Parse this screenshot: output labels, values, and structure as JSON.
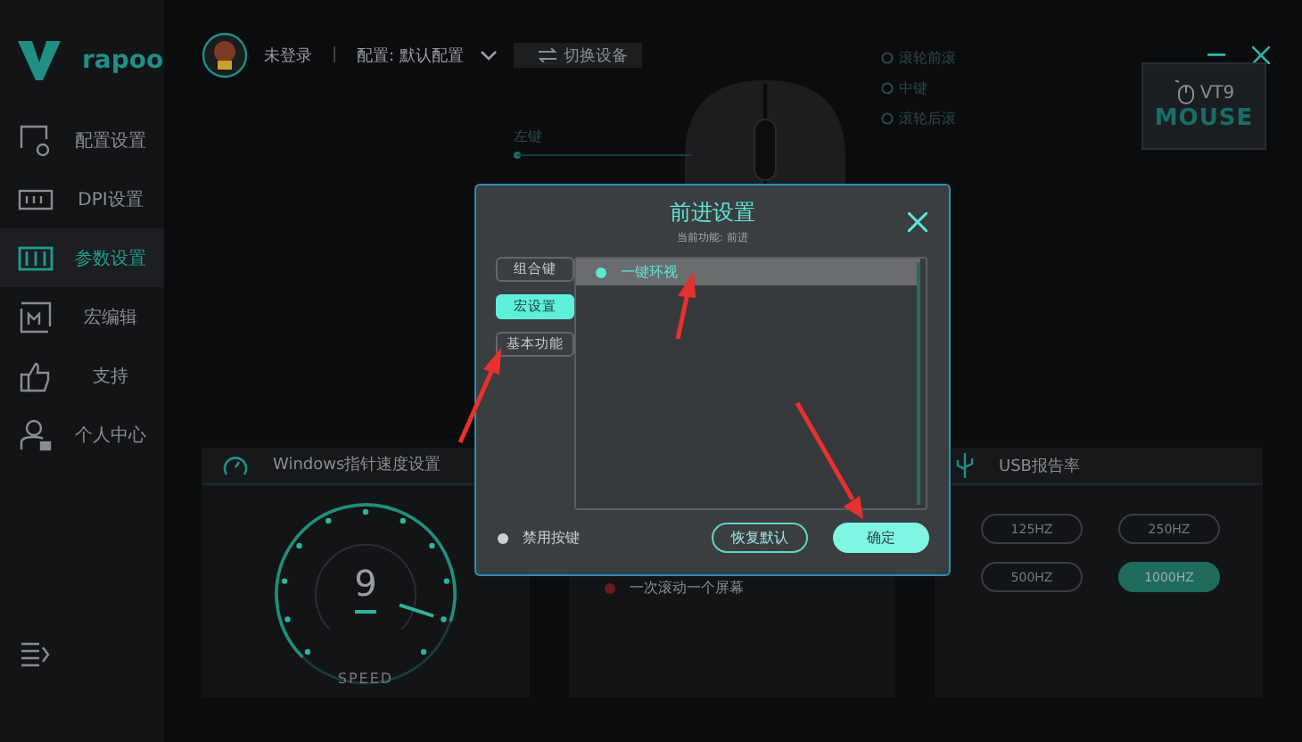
{
  "logo": {
    "text": "rapoo"
  },
  "sidebar": {
    "items": [
      {
        "label": "配置设置",
        "selected": false
      },
      {
        "label": "DPI设置",
        "selected": false
      },
      {
        "label": "参数设置",
        "selected": true
      },
      {
        "label": "宏编辑",
        "selected": false
      },
      {
        "label": "支持",
        "selected": false
      },
      {
        "label": "个人中心",
        "selected": false
      }
    ]
  },
  "topbar": {
    "user": "未登录",
    "separator": "|",
    "profile": "配置: 默认配置",
    "switch_device": "切换设备"
  },
  "device_badge": {
    "model": "VT9",
    "type": "MOUSE"
  },
  "mouse_labels": {
    "left": [
      "左键"
    ],
    "right": [
      "滚轮前滚",
      "中键",
      "滚轮后滚"
    ]
  },
  "pointer_panel": {
    "title": "Windows指针速度设置",
    "speed": "9",
    "caption": "SPEED"
  },
  "scroll_panel": {
    "option": "一次滚动一个屏幕"
  },
  "usb_panel": {
    "title": "USB报告率",
    "rates": [
      {
        "label": "125HZ",
        "selected": false
      },
      {
        "label": "250HZ",
        "selected": false
      },
      {
        "label": "500HZ",
        "selected": false
      },
      {
        "label": "1000HZ",
        "selected": true
      }
    ]
  },
  "dialog": {
    "title": "前进设置",
    "subtitle": "当前功能: 前进",
    "tabs": [
      {
        "label": "组合键",
        "selected": false
      },
      {
        "label": "宏设置",
        "selected": true
      },
      {
        "label": "基本功能",
        "selected": false
      }
    ],
    "list": [
      {
        "label": "一键环视",
        "selected": true
      }
    ],
    "disable_key": {
      "label": "禁用按键",
      "checked": false
    },
    "buttons": [
      {
        "label": "恢复默认",
        "kind": "outline"
      },
      {
        "label": "确定",
        "kind": "primary"
      }
    ]
  }
}
